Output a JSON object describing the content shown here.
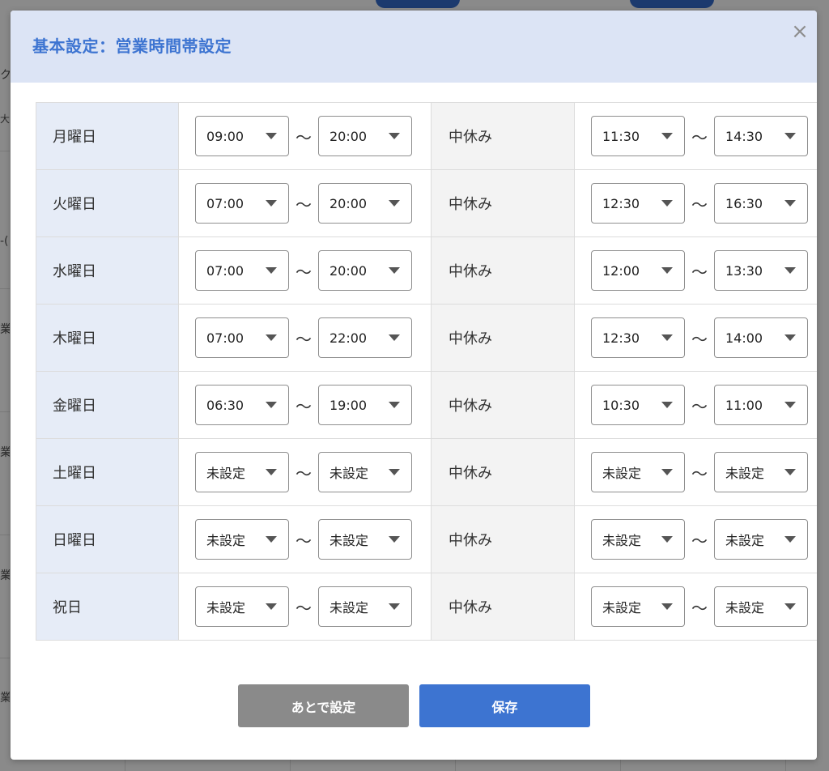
{
  "background": {
    "fragments": [
      "ク",
      "大美",
      "-(",
      "業",
      "業",
      "業",
      "業"
    ]
  },
  "modal": {
    "title": "基本設定：営業時間帯設定",
    "close_label": "×"
  },
  "schedule": {
    "separator": "～",
    "break_label": "中休み",
    "rows": [
      {
        "day": "月曜日",
        "open": "09:00",
        "close": "20:00",
        "break_start": "11:30",
        "break_end": "14:30"
      },
      {
        "day": "火曜日",
        "open": "07:00",
        "close": "20:00",
        "break_start": "12:30",
        "break_end": "16:30"
      },
      {
        "day": "水曜日",
        "open": "07:00",
        "close": "20:00",
        "break_start": "12:00",
        "break_end": "13:30"
      },
      {
        "day": "木曜日",
        "open": "07:00",
        "close": "22:00",
        "break_start": "12:30",
        "break_end": "14:00"
      },
      {
        "day": "金曜日",
        "open": "06:30",
        "close": "19:00",
        "break_start": "10:30",
        "break_end": "11:00"
      },
      {
        "day": "土曜日",
        "open": "未設定",
        "close": "未設定",
        "break_start": "未設定",
        "break_end": "未設定"
      },
      {
        "day": "日曜日",
        "open": "未設定",
        "close": "未設定",
        "break_start": "未設定",
        "break_end": "未設定"
      },
      {
        "day": "祝日",
        "open": "未設定",
        "close": "未設定",
        "break_start": "未設定",
        "break_end": "未設定"
      }
    ]
  },
  "actions": {
    "later_label": "あとで設定",
    "save_label": "保存"
  }
}
